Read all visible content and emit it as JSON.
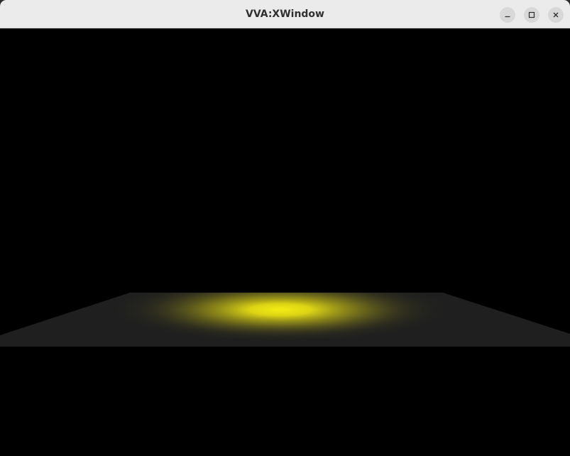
{
  "window": {
    "title": "VVA:XWindow",
    "controls": {
      "minimize_icon": "minimize-icon",
      "maximize_icon": "maximize-icon",
      "close_icon": "close-icon"
    }
  },
  "scene": {
    "background_color": "#000000",
    "floor_color": "#1f1f1f",
    "spotlight_color": "#f0ea1a"
  }
}
